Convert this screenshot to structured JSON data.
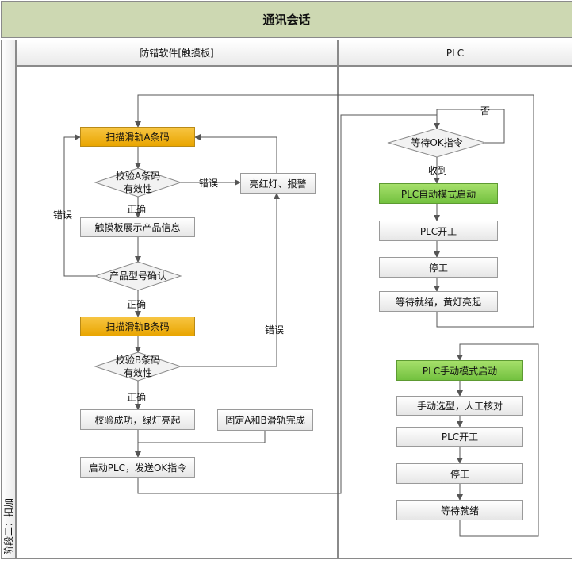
{
  "title": "通讯会话",
  "lanes": {
    "left": "防错软件[触摸板]",
    "right": "PLC"
  },
  "stage_label": "阶段二：扣加",
  "nodes": {
    "scan_a": "扫描滑轨A条码",
    "verify_a": "校验A条码有效性",
    "alarm": "亮红灯、报警",
    "show_info": "触摸板展示产品信息",
    "confirm_model": "产品型号确认",
    "scan_b": "扫描滑轨B条码",
    "verify_b": "校验B条码有效性",
    "verify_ok": "校验成功，绿灯亮起",
    "fixed": "固定A和B滑轨完成",
    "start_plc": "启动PLC，发送OK指令",
    "wait_ok": "等待OK指令",
    "plc_auto": "PLC自动模式启动",
    "plc_start_1": "PLC开工",
    "stop_1": "停工",
    "wait_ready_yellow": "等待就绪，黄灯亮起",
    "plc_manual": "PLC手动模式启动",
    "manual_select": "手动选型，人工核对",
    "plc_start_2": "PLC开工",
    "stop_2": "停工",
    "wait_ready": "等待就绪"
  },
  "edges": {
    "error_1": "错误",
    "correct_1": "正确",
    "error_2": "错误",
    "correct_2": "正确",
    "error_3": "错误",
    "correct_3": "正确",
    "no": "否",
    "received": "收到"
  },
  "colors": {
    "header_bg": "#cdd8b2",
    "orange": "#f0b31c",
    "green": "#8fd159",
    "line": "#555555"
  }
}
